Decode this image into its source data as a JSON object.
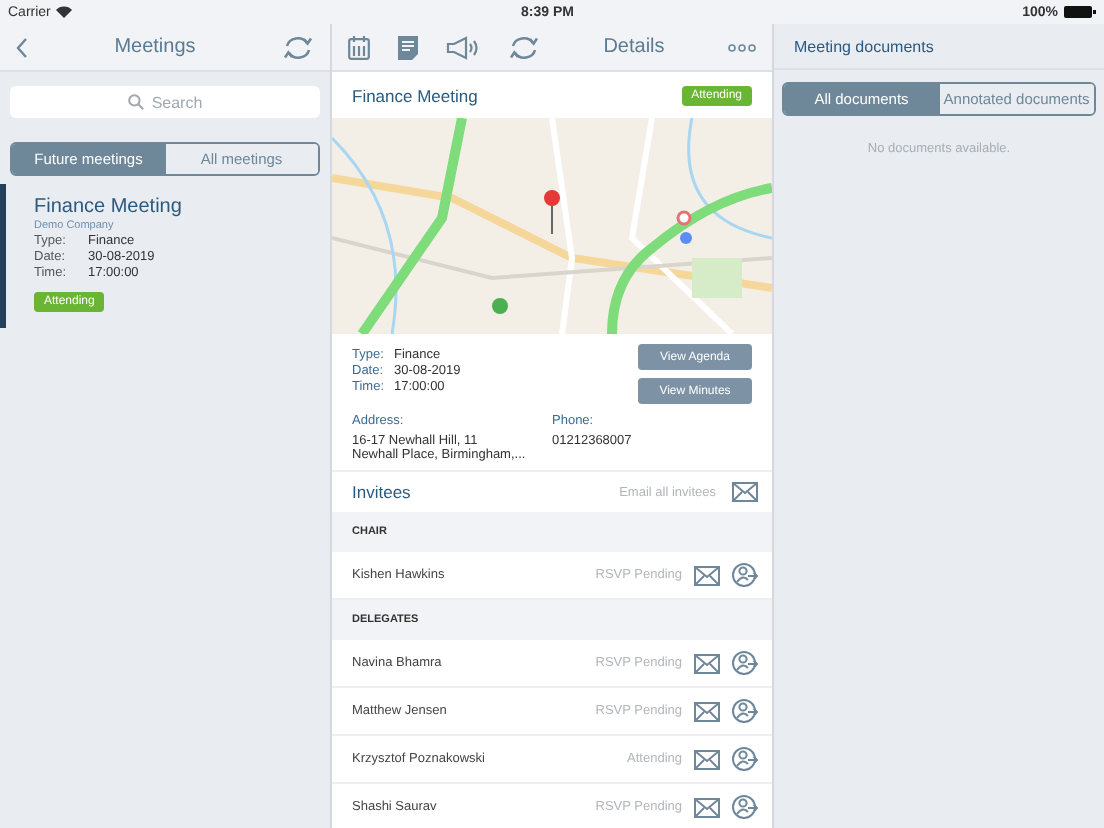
{
  "status_bar": {
    "carrier": "Carrier",
    "time": "8:39 PM",
    "battery": "100%"
  },
  "left_nav": {
    "title": "Meetings"
  },
  "detail_nav": {
    "title": "Details"
  },
  "search": {
    "placeholder": "Search"
  },
  "meeting_tabs": [
    {
      "label": "Future meetings",
      "selected": true
    },
    {
      "label": "All meetings",
      "selected": false
    }
  ],
  "meetings": [
    {
      "title": "Finance Meeting",
      "company": "Demo Company",
      "selected": true,
      "status": "Attending",
      "fields": [
        {
          "label": "Type:",
          "value": "Finance"
        },
        {
          "label": "Date:",
          "value": "30-08-2019"
        },
        {
          "label": "Time:",
          "value": "17:00:00"
        }
      ]
    }
  ],
  "details": {
    "title": "Finance Meeting",
    "status": "Attending",
    "fields": [
      {
        "label": "Type:",
        "value": "Finance"
      },
      {
        "label": "Date:",
        "value": "30-08-2019"
      },
      {
        "label": "Time:",
        "value": "17:00:00"
      }
    ],
    "buttons": [
      "View Agenda",
      "View Minutes"
    ],
    "address_label": "Address:",
    "address_lines": [
      "16-17 Newhall Hill, 11",
      "Newhall Place, Birmingham,..."
    ],
    "phone_label": "Phone:",
    "phone": "01212368007"
  },
  "invitees": {
    "title": "Invitees",
    "email_all": "Email all invitees",
    "groups": [
      {
        "heading": "CHAIR",
        "people": [
          {
            "name": "Kishen Hawkins",
            "status": "RSVP Pending"
          }
        ]
      },
      {
        "heading": "DELEGATES",
        "people": [
          {
            "name": "Navina Bhamra",
            "status": "RSVP Pending"
          },
          {
            "name": "Matthew Jensen",
            "status": "RSVP Pending"
          },
          {
            "name": "Krzysztof Poznakowski",
            "status": "Attending"
          },
          {
            "name": "Shashi Saurav",
            "status": "RSVP Pending"
          }
        ]
      }
    ]
  },
  "documents": {
    "title": "Meeting documents",
    "tabs": [
      {
        "label": "All documents",
        "selected": true
      },
      {
        "label": "Annotated documents",
        "selected": false
      }
    ],
    "empty_text": "No documents available."
  }
}
